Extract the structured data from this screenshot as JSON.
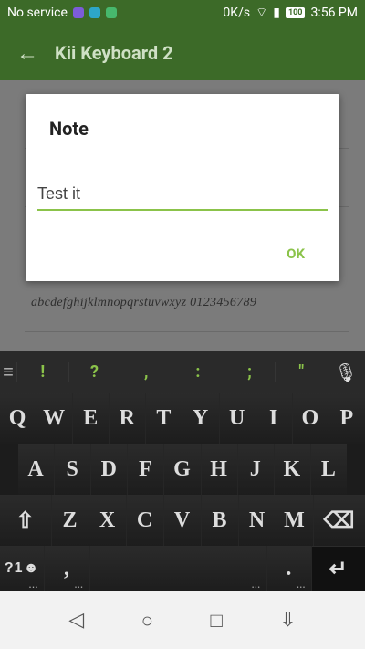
{
  "status": {
    "carrier": "No service",
    "speed": "0K/s",
    "battery": "100",
    "time": "3:56 PM"
  },
  "appbar": {
    "title": "Kii Keyboard 2",
    "back_icon": "←"
  },
  "content": {
    "sample_text": "abcdefghijklmnopqrstuvwxyz 0123456789"
  },
  "dialog": {
    "title": "Note",
    "input_value": "Test it",
    "ok_label": "OK"
  },
  "keyboard": {
    "suggest_symbols": [
      "!",
      "?",
      ",",
      ":",
      ";",
      "\""
    ],
    "row1": [
      "Q",
      "W",
      "E",
      "R",
      "T",
      "Y",
      "U",
      "I",
      "O",
      "P"
    ],
    "row2": [
      "A",
      "S",
      "D",
      "F",
      "G",
      "H",
      "J",
      "K",
      "L"
    ],
    "row3": [
      "Z",
      "X",
      "C",
      "V",
      "B",
      "N",
      "M"
    ],
    "symbols_key": "?1",
    "comma_key": ",",
    "period_key": ".",
    "enter_icon": "↵"
  },
  "navbar": {
    "back": "◁",
    "home": "○",
    "recents": "□",
    "hide": "⇩"
  }
}
